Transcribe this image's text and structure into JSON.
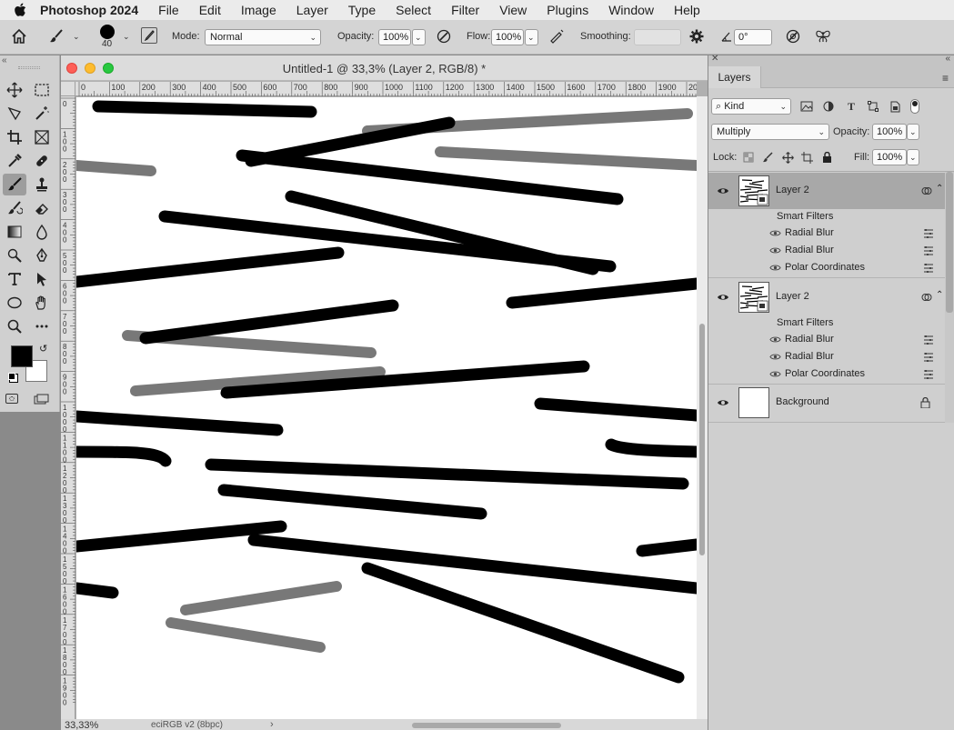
{
  "menubar": {
    "app_name": "Photoshop 2024",
    "items": [
      "File",
      "Edit",
      "Image",
      "Layer",
      "Type",
      "Select",
      "Filter",
      "View",
      "Plugins",
      "Window",
      "Help"
    ]
  },
  "options": {
    "brush_size": "40",
    "mode_label": "Mode:",
    "mode_value": "Normal",
    "opacity_label": "Opacity:",
    "opacity_value": "100%",
    "flow_label": "Flow:",
    "flow_value": "100%",
    "smoothing_label": "Smoothing:",
    "smoothing_value": "",
    "angle_value": "0°"
  },
  "document": {
    "title": "Untitled-1 @ 33,3% (Layer 2, RGB/8) *",
    "zoom": "33,33%",
    "color_profile": "eciRGB v2 (8bpc)",
    "ruler_h": [
      "0",
      "100",
      "200",
      "300",
      "400",
      "500",
      "600",
      "700",
      "800",
      "900",
      "1000",
      "1100",
      "1200",
      "1300",
      "1400",
      "1500",
      "1600",
      "1700",
      "1800",
      "1900",
      "200"
    ],
    "ruler_v": [
      "0",
      "100",
      "200",
      "300",
      "400",
      "500",
      "600",
      "700",
      "800",
      "900",
      "1000",
      "1100",
      "1200",
      "1300",
      "1400",
      "1500",
      "1600",
      "1700",
      "1800",
      "1900"
    ]
  },
  "layers_panel": {
    "tab": "Layers",
    "filter_kind": "Kind",
    "blend_mode": "Multiply",
    "opacity_label": "Opacity:",
    "opacity_value": "100%",
    "lock_label": "Lock:",
    "fill_label": "Fill:",
    "fill_value": "100%",
    "layers": [
      {
        "name": "Layer 2",
        "selected": true,
        "smart_filters_label": "Smart Filters",
        "filters": [
          "Radial Blur",
          "Radial Blur",
          "Polar Coordinates"
        ]
      },
      {
        "name": "Layer 2",
        "selected": false,
        "smart_filters_label": "Smart Filters",
        "filters": [
          "Radial Blur",
          "Radial Blur",
          "Polar Coordinates"
        ]
      },
      {
        "name": "Background",
        "selected": false,
        "locked": true
      }
    ]
  },
  "colors": {
    "foreground": "#000000",
    "background": "#ffffff",
    "stroke_black": "#000000",
    "stroke_gray": "#787878"
  }
}
